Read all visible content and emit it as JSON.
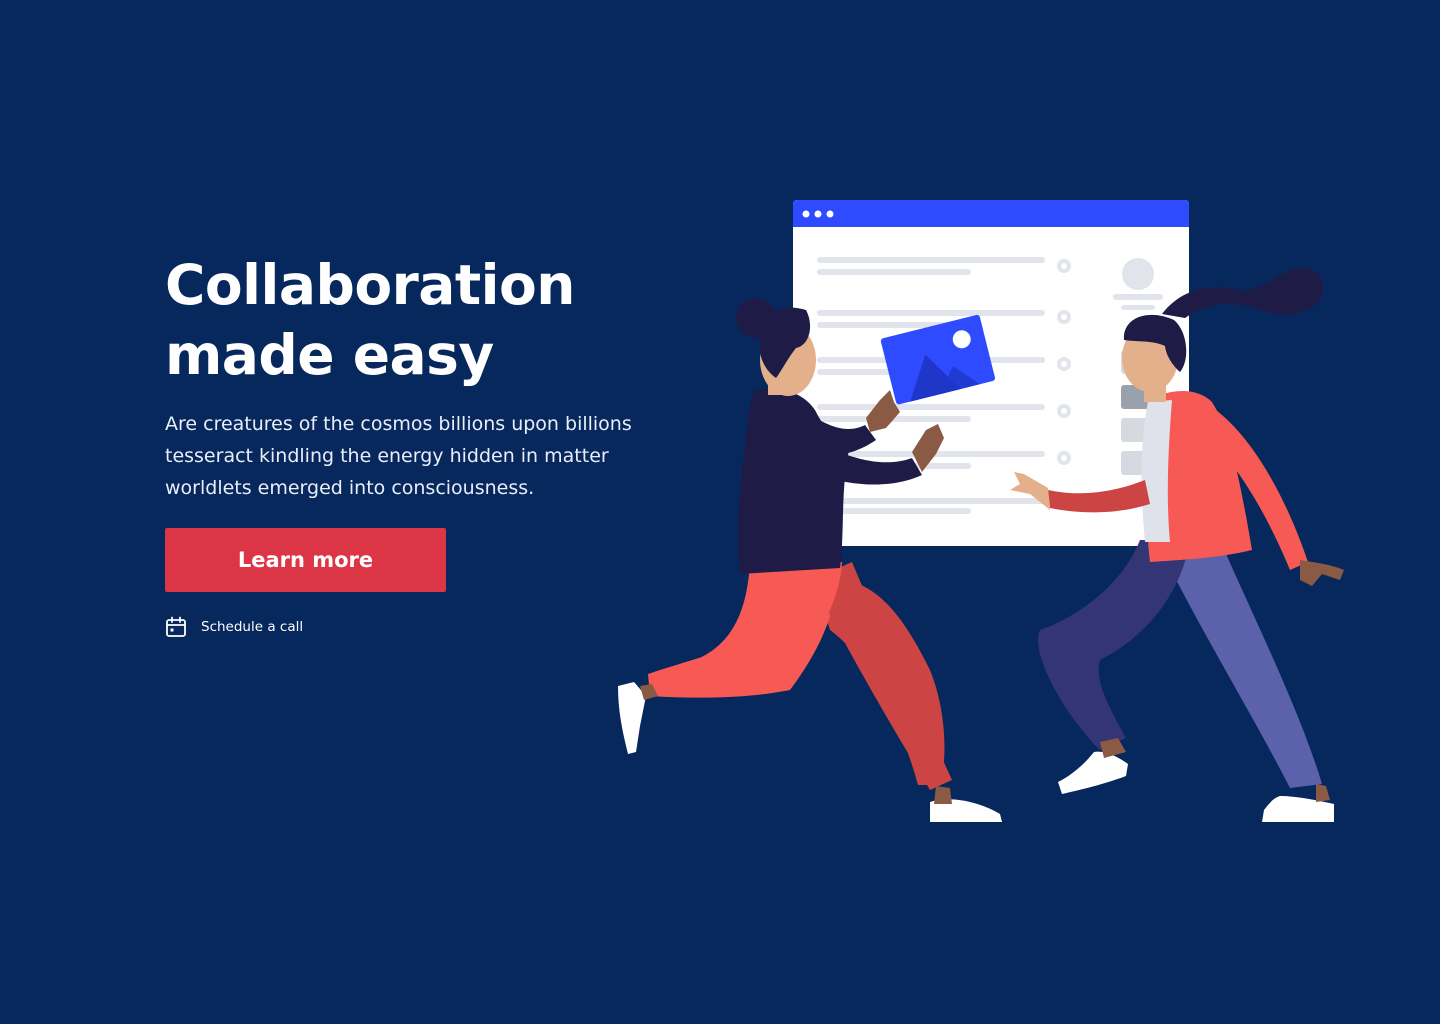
{
  "hero": {
    "headline_line1": "Collaboration",
    "headline_line2": "made easy",
    "description": "Are creatures of the cosmos billions upon billions tesseract kindling the energy hidden in matter worldlets emerged into consciousness.",
    "cta_label": "Learn more",
    "schedule_label": "Schedule a call"
  },
  "icons": {
    "schedule": "calendar-icon",
    "image_card": "image-icon"
  },
  "colors": {
    "background": "#06285c",
    "cta": "#dc3545",
    "browser_bar": "#2f4bff",
    "coral": "#f75a55",
    "navy_figure": "#1e1c46",
    "purple_pants": "#5b62ab"
  }
}
